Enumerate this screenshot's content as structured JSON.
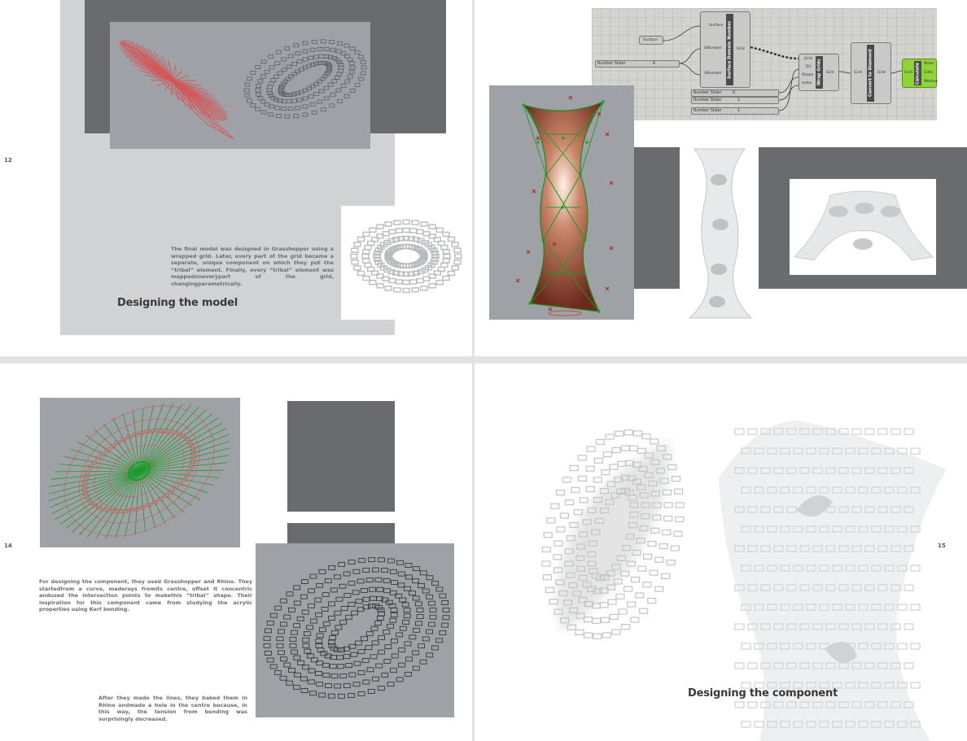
{
  "pages": {
    "p12": {
      "number": "12",
      "heading": "Designing the model",
      "paragraph": "The final model was designed in Grasshopper using a wrapped grid. Later, every part of the grid became a separate, unique component on which they put the “tribal” element. Finally, every “tribal” element was mappedoneverypart of the grid, changingparametrically."
    },
    "p13": {
      "grasshopper": {
        "surface_param": "Surface",
        "sdn_title": "Surface Domain Number",
        "sdn_inputs": [
          "Surface",
          "UNumber",
          "VNumber"
        ],
        "sdn_output": "Grid",
        "wrap_title": "Wrap Grids",
        "wrap_inputs": [
          "Grid",
          "Dir",
          "Shape",
          "Index"
        ],
        "wrap_output": "Grid",
        "diamond_title": "Convert to Diamond",
        "diamond_input": "Grid",
        "diamond_output": "Grid",
        "calc_title": "Calculate",
        "calc_input": "Grid",
        "calc_outputs": [
          "Wires",
          "Cells",
          "Meshes"
        ],
        "sliders": [
          {
            "label": "Number Slider",
            "value": "6"
          },
          {
            "label": "Number Slider",
            "value": "0"
          },
          {
            "label": "Number Slider",
            "value": "1"
          },
          {
            "label": "Number Slider",
            "value": "1"
          }
        ]
      }
    },
    "p14": {
      "number": "14",
      "paragraph1": "For designing the component, they used Grasshopper and Rhino. They startedfrom a curve, maderays fromits centre, offset it concentric andused the intersection points to makethis “tribal” shape. Their inspiration for this component came from studying the acrylic properties using Kerf bending.",
      "paragraph2": "After they made the lines, they baked them in Rhino andmade a hole in the centre because, in this way, the tension from bending was surprisingly decreased."
    },
    "p15": {
      "number": "15",
      "heading": "Designing the component"
    }
  },
  "colors": {
    "dark_block": "#6a6b6e",
    "light_block": "#d1d2d4",
    "viewport": "#9ea1a5",
    "red_lines": "#d2585a",
    "green_lines": "#1e9c2a",
    "gh_green": "#8fd23a"
  }
}
